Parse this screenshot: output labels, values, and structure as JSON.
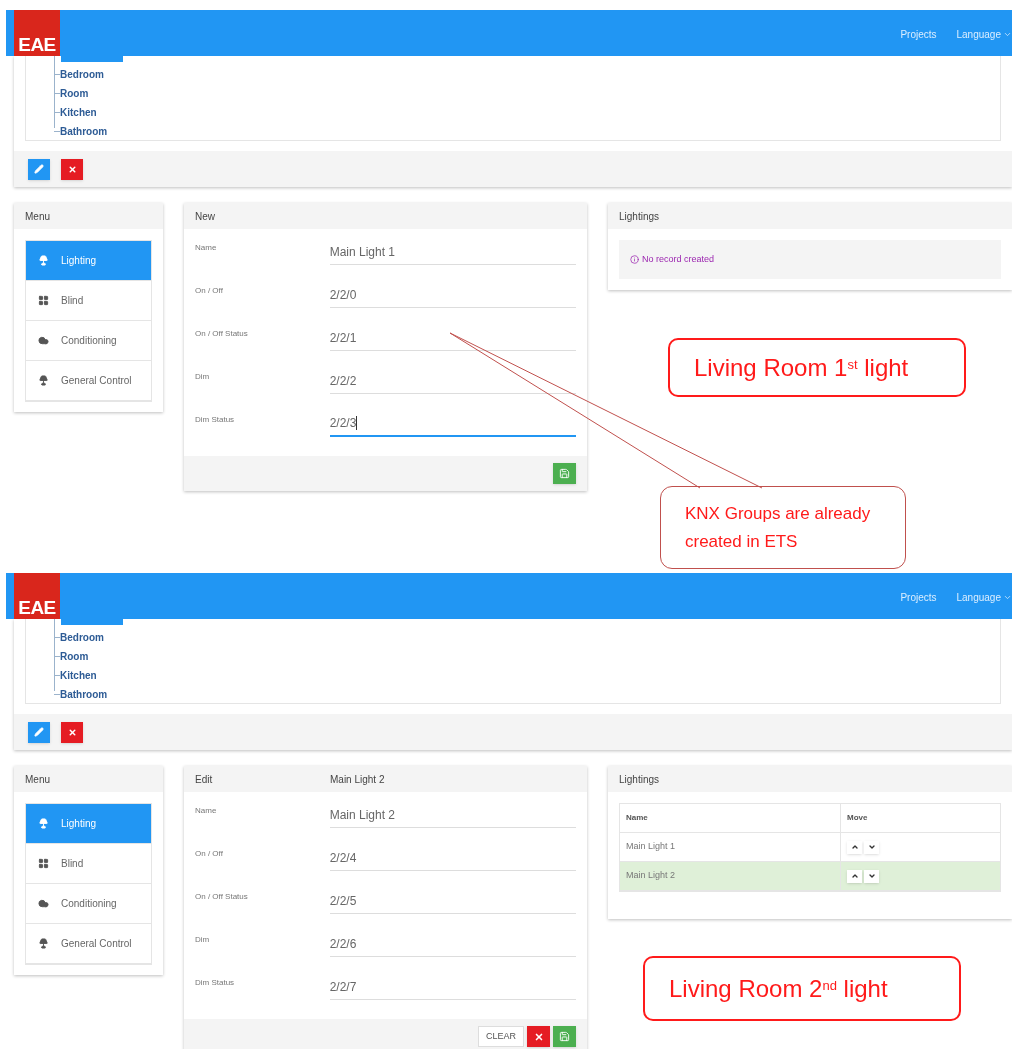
{
  "screens": [
    {
      "header": {
        "logo": "EAE",
        "nav": [
          {
            "label": "Projects",
            "caret": false
          },
          {
            "label": "Language",
            "caret": true
          }
        ]
      },
      "tree": [
        "Bedroom",
        "Room",
        "Kitchen",
        "Bathroom"
      ],
      "menu": {
        "title": "Menu",
        "items": [
          {
            "label": "Lighting",
            "kind": "lamp",
            "selected": true
          },
          {
            "label": "Blind",
            "kind": "grid",
            "selected": false
          },
          {
            "label": "Conditioning",
            "kind": "cloud",
            "selected": false
          },
          {
            "label": "General Control",
            "kind": "lamp",
            "selected": false
          }
        ]
      },
      "form": {
        "title": "New",
        "fields": [
          {
            "label": "Name",
            "value": "Main Light 1",
            "focused": false
          },
          {
            "label": "On / Off",
            "value": "2/2/0",
            "focused": false
          },
          {
            "label": "On / Off Status",
            "value": "2/2/1",
            "focused": false
          },
          {
            "label": "Dim",
            "value": "2/2/2",
            "focused": false
          },
          {
            "label": "Dim Status",
            "value": "2/2/3",
            "focused": true
          }
        ],
        "buttons": [
          {
            "kind": "save"
          }
        ]
      },
      "lightings": {
        "title": "Lightings",
        "empty_message": "No record created"
      },
      "callouts": [
        {
          "kind": "box",
          "text": "Living Room 1$^{st}$ light"
        },
        {
          "kind": "pointer",
          "text": "KNX Groups are already created in ETS"
        }
      ]
    },
    {
      "header": {
        "logo": "EAE",
        "nav": [
          {
            "label": "Projects",
            "caret": false
          },
          {
            "label": "Language",
            "caret": true
          }
        ]
      },
      "tree": [
        "Bedroom",
        "Room",
        "Kitchen",
        "Bathroom"
      ],
      "menu": {
        "title": "Menu",
        "items": [
          {
            "label": "Lighting",
            "kind": "lamp",
            "selected": true
          },
          {
            "label": "Blind",
            "kind": "grid",
            "selected": false
          },
          {
            "label": "Conditioning",
            "kind": "cloud",
            "selected": false
          },
          {
            "label": "General Control",
            "kind": "lamp",
            "selected": false
          }
        ]
      },
      "form": {
        "title": "Edit",
        "subtitle": "Main Light 2",
        "fields": [
          {
            "label": "Name",
            "value": "Main Light 2",
            "focused": false
          },
          {
            "label": "On / Off",
            "value": "2/2/4",
            "focused": false
          },
          {
            "label": "On / Off Status",
            "value": "2/2/5",
            "focused": false
          },
          {
            "label": "Dim",
            "value": "2/2/6",
            "focused": false
          },
          {
            "label": "Dim Status",
            "value": "2/2/7",
            "focused": false
          }
        ],
        "buttons": [
          {
            "kind": "clear",
            "label": "CLEAR"
          },
          {
            "kind": "delete"
          },
          {
            "kind": "save"
          }
        ]
      },
      "lightings": {
        "title": "Lightings",
        "columns": [
          "Name",
          "Move"
        ],
        "rows": [
          {
            "name": "Main Light 1",
            "selected": false
          },
          {
            "name": "Main Light 2",
            "selected": true
          }
        ]
      },
      "callouts": [
        {
          "kind": "box",
          "text": "Living Room 2$^{nd}$ light"
        }
      ]
    }
  ]
}
